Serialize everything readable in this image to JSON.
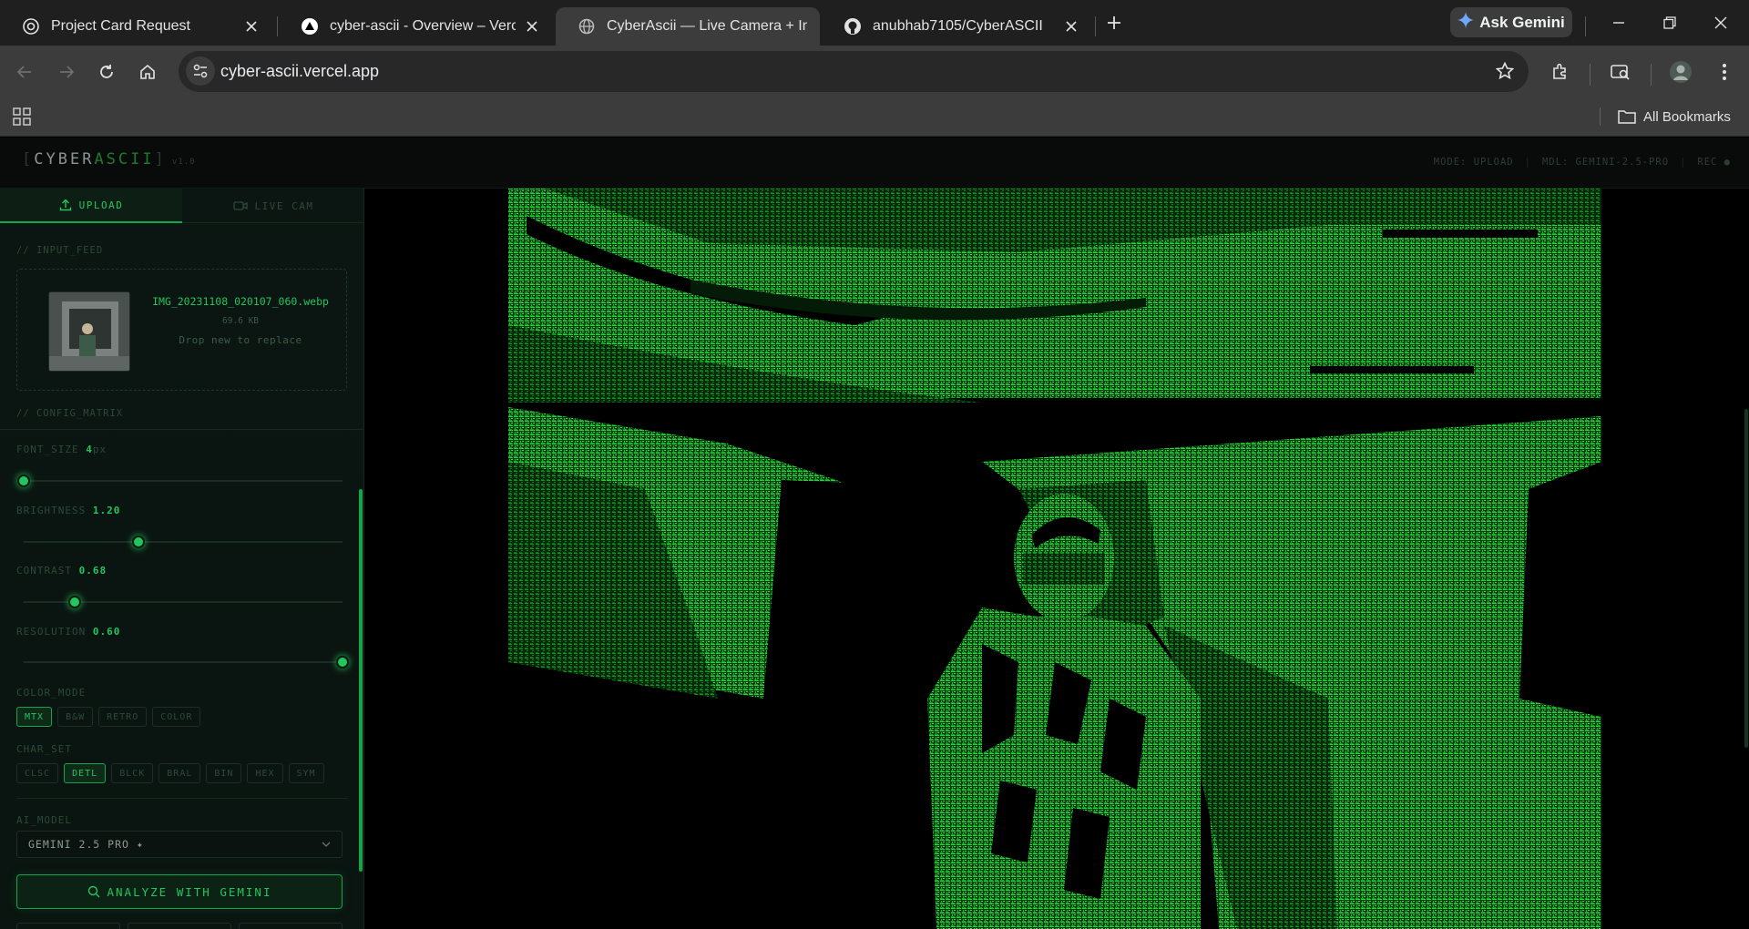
{
  "browser": {
    "tabs": [
      {
        "title": "Project Card Request",
        "icon": "openai-icon"
      },
      {
        "title": "cyber-ascii - Overview – Vercel",
        "icon": "vercel-icon"
      },
      {
        "title": "CyberAscii — Live Camera + Im",
        "icon": "globe-icon"
      },
      {
        "title": "anubhab7105/CyberASCII",
        "icon": "github-icon"
      }
    ],
    "gemini_label": "Ask Gemini",
    "url": "cyber-ascii.vercel.app",
    "bookmarks_label": "All Bookmarks"
  },
  "app": {
    "logo": {
      "bracket_open": "[",
      "part1": "CYBER",
      "part2": "ASCII",
      "bracket_close": "]",
      "version": "v1.0"
    },
    "status": {
      "mode": "MODE: UPLOAD",
      "model": "MDL: GEMINI-2.5-PRO",
      "rec": "REC ●"
    },
    "tabs": {
      "upload": "UPLOAD",
      "live_cam": "LIVE CAM"
    },
    "input_feed": {
      "label": "// INPUT_FEED",
      "file_name": "IMG_20231108_020107_060.webp",
      "file_size": "69.6 KB",
      "hint": "Drop new to replace"
    },
    "config_label": "// CONFIG_MATRIX",
    "controls": {
      "font_size": {
        "label": "FONT_SIZE",
        "value": "4",
        "unit": "px",
        "level": 0.0
      },
      "brightness": {
        "label": "BRIGHTNESS",
        "value": "1.20",
        "level": 0.36
      },
      "contrast": {
        "label": "CONTRAST",
        "value": "0.68",
        "level": 0.16
      },
      "resolution": {
        "label": "RESOLUTION",
        "value": "0.60",
        "level": 1.0
      }
    },
    "color_mode": {
      "label": "COLOR_MODE",
      "options": [
        "MTX",
        "B&W",
        "RETRO",
        "COLOR"
      ],
      "selected": "MTX"
    },
    "char_set": {
      "label": "CHAR_SET",
      "options": [
        "CLSC",
        "DETL",
        "BLCK",
        "BRAL",
        "BIN",
        "HEX",
        "SYM"
      ],
      "selected": "DETL"
    },
    "ai_model": {
      "label": "AI_MODEL",
      "selected": "GEMINI 2.5 PRO ✦"
    },
    "analyze_label": "ANALYZE WITH GEMINI",
    "colors": {
      "accent": "#22c55e",
      "ascii": "#1fb82d",
      "background": "#000000"
    }
  }
}
